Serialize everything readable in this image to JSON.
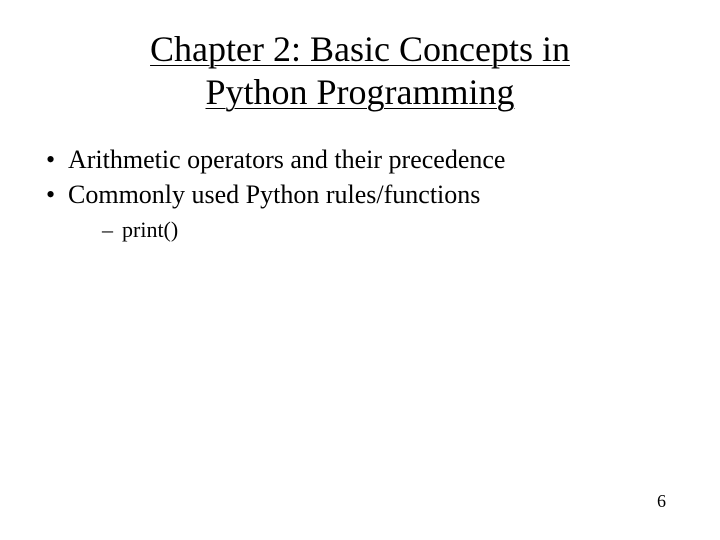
{
  "slide": {
    "title_line1": "Chapter 2: Basic Concepts in",
    "title_line2": "Python Programming",
    "bullets": [
      "Arithmetic operators and their precedence",
      "Commonly used Python rules/functions"
    ],
    "subbullets": [
      "print()"
    ],
    "page_number": "6"
  }
}
